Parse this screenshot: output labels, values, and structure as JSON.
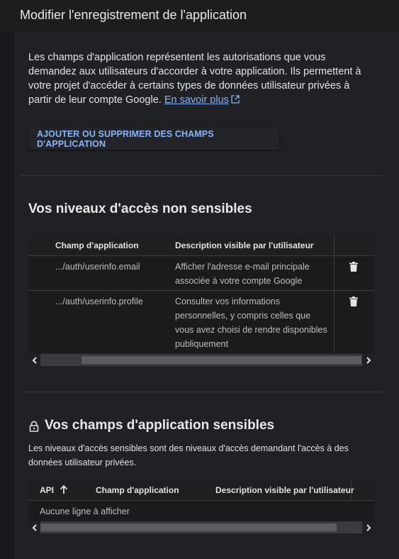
{
  "header": {
    "title": "Modifier l'enregistrement de l'application"
  },
  "intro": {
    "text": "Les champs d'application représentent les autorisations que vous demandez aux utilisateurs d'accorder à votre application. Ils permettent à votre projet d'accéder à certains types de données utilisateur privées à partir de leur compte Google.",
    "link_label": "En savoir plus"
  },
  "scopes_button": {
    "label": "AJOUTER OU SUPPRIMER DES CHAMPS D'APPLICATION"
  },
  "non_sensitive": {
    "title": "Vos niveaux d'accès non sensibles",
    "columns": {
      "scope": "Champ d'application",
      "description": "Description visible par l'utilisateur"
    },
    "rows": [
      {
        "scope": ".../auth/userinfo.email",
        "description": "Afficher l'adresse e-mail principale associée à votre compte Google"
      },
      {
        "scope": ".../auth/userinfo.profile",
        "description": "Consulter vos informations personnelles, y compris celles que vous avez choisi de rendre disponibles publiquement"
      }
    ]
  },
  "sensitive": {
    "title": "Vos champs d'application sensibles",
    "description": "Les niveaux d'accès sensibles sont des niveaux d'accès demandant l'accès à des données utilisateur privées.",
    "columns": {
      "api": "API",
      "scope": "Champ d'application",
      "description": "Description visible par l'utilisateur"
    },
    "empty_text": "Aucune ligne à afficher"
  },
  "colors": {
    "accent": "#8ab4f8",
    "background": "#202124"
  },
  "icons": [
    "external-link-icon",
    "lock-icon",
    "trash-icon",
    "arrow-up-icon",
    "chevron-left-icon",
    "chevron-right-icon"
  ]
}
